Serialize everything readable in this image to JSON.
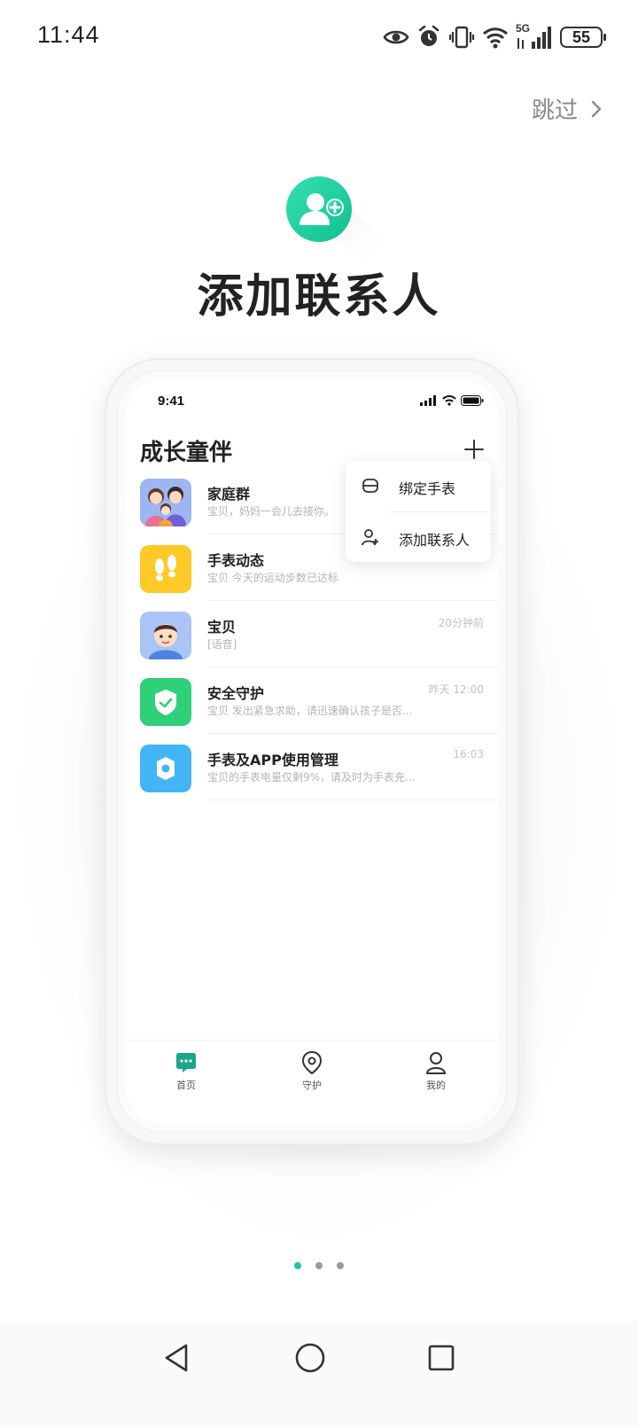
{
  "status_bar": {
    "time": "11:44",
    "network": "5G",
    "battery": "55",
    "icons": [
      "eye-icon",
      "alarm-icon",
      "vibrate-icon",
      "wifi-icon",
      "signal-icon",
      "battery-icon"
    ]
  },
  "skip": {
    "label": "跳过",
    "icon": "chevron-right-icon"
  },
  "hero": {
    "icon": "add-contact-icon",
    "title": "添加联系人"
  },
  "phone": {
    "status_time": "9:41",
    "header_title": "成长童伴",
    "plus_icon": "plus-icon",
    "popup_menu": [
      {
        "icon": "watch-icon",
        "label": "绑定手表"
      },
      {
        "icon": "add-user-icon",
        "label": "添加联系人"
      }
    ],
    "chats": [
      {
        "avatar": "family-avatar",
        "name": "家庭群",
        "preview": "宝贝，妈妈一会儿去接你。",
        "time": ""
      },
      {
        "avatar": "footprints-avatar",
        "name": "手表动态",
        "preview": "宝贝 今天的运动步数已达标",
        "time": ""
      },
      {
        "avatar": "boy-avatar",
        "name": "宝贝",
        "preview": "[语音]",
        "time": "20分钟前"
      },
      {
        "avatar": "shield-avatar",
        "name": "安全守护",
        "preview": "宝贝 发出紧急求助，请迅速确认孩子是否...",
        "time": "昨天 12:00"
      },
      {
        "avatar": "settings-avatar",
        "name": "手表及APP使用管理",
        "preview": "宝贝的手表电量仅剩9%，请及时为手表充...",
        "time": "16:03"
      }
    ],
    "tabs": [
      {
        "icon": "chat-icon",
        "label": "首页"
      },
      {
        "icon": "location-icon",
        "label": "守护"
      },
      {
        "icon": "profile-icon",
        "label": "我的"
      }
    ],
    "colors": {
      "accent": "#1cc7a0",
      "yellow": "#ffc928",
      "green": "#2fd079",
      "blue": "#42b5f5"
    }
  },
  "pagination": {
    "total": 3,
    "active": 1
  },
  "nav": {
    "icons": [
      "back-icon",
      "home-icon",
      "recents-icon"
    ]
  }
}
